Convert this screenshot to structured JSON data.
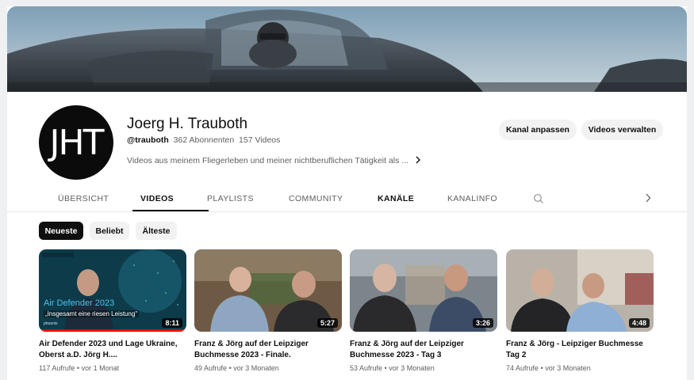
{
  "channel": {
    "avatar_text": "JHT",
    "name": "Joerg H. Trauboth",
    "handle": "@trauboth",
    "subscribers": "362 Abonnenten",
    "videos_count": "157 Videos",
    "description": "Videos aus meinem Fliegerleben und meiner nichtberuflichen Tätigkeit als ..."
  },
  "buttons": {
    "customize": "Kanal anpassen",
    "manage": "Videos verwalten"
  },
  "tabs": [
    {
      "label": "ÜBERSICHT",
      "active": false
    },
    {
      "label": "VIDEOS",
      "active": true
    },
    {
      "label": "PLAYLISTS",
      "active": false
    },
    {
      "label": "COMMUNITY",
      "active": false
    },
    {
      "label": "KANÄLE",
      "active": false
    },
    {
      "label": "KANALINFO",
      "active": false
    }
  ],
  "icons": {
    "search": "search-icon",
    "tabs_next": "chevron-right-icon",
    "description_more": "chevron-right-icon"
  },
  "filters": [
    {
      "label": "Neueste",
      "active": true
    },
    {
      "label": "Beliebt",
      "active": false
    },
    {
      "label": "Älteste",
      "active": false
    }
  ],
  "videos": [
    {
      "title": "Air Defender 2023 und Lage Ukraine, Oberst a.D. Jörg H....",
      "duration": "8:11",
      "views": "117 Aufrufe",
      "age": "vor 1 Monat",
      "thumb_title": "Air Defender 2023",
      "thumb_quote": "„Insgesamt eine riesen Leistung\"",
      "thumb_brand": "phoenix",
      "watched_fraction": 1.0
    },
    {
      "title": "Franz & Jörg auf der Leipziger Buchmesse 2023 - Finale.",
      "duration": "5:27",
      "views": "49 Aufrufe",
      "age": "vor 3 Monaten"
    },
    {
      "title": "Franz & Jörg auf der Leipziger Buchmesse 2023 - Tag 3",
      "duration": "3:26",
      "views": "53 Aufrufe",
      "age": "vor 3 Monaten"
    },
    {
      "title": "Franz & Jörg - Leipziger Buchmesse Tag 2",
      "duration": "4:48",
      "views": "74 Aufrufe",
      "age": "vor 3 Monaten"
    }
  ],
  "meta_separator": "•",
  "colors": {
    "accent_active_chip": "#0f0f0f",
    "progress": "#ff0000",
    "secondary_text": "#606060"
  }
}
